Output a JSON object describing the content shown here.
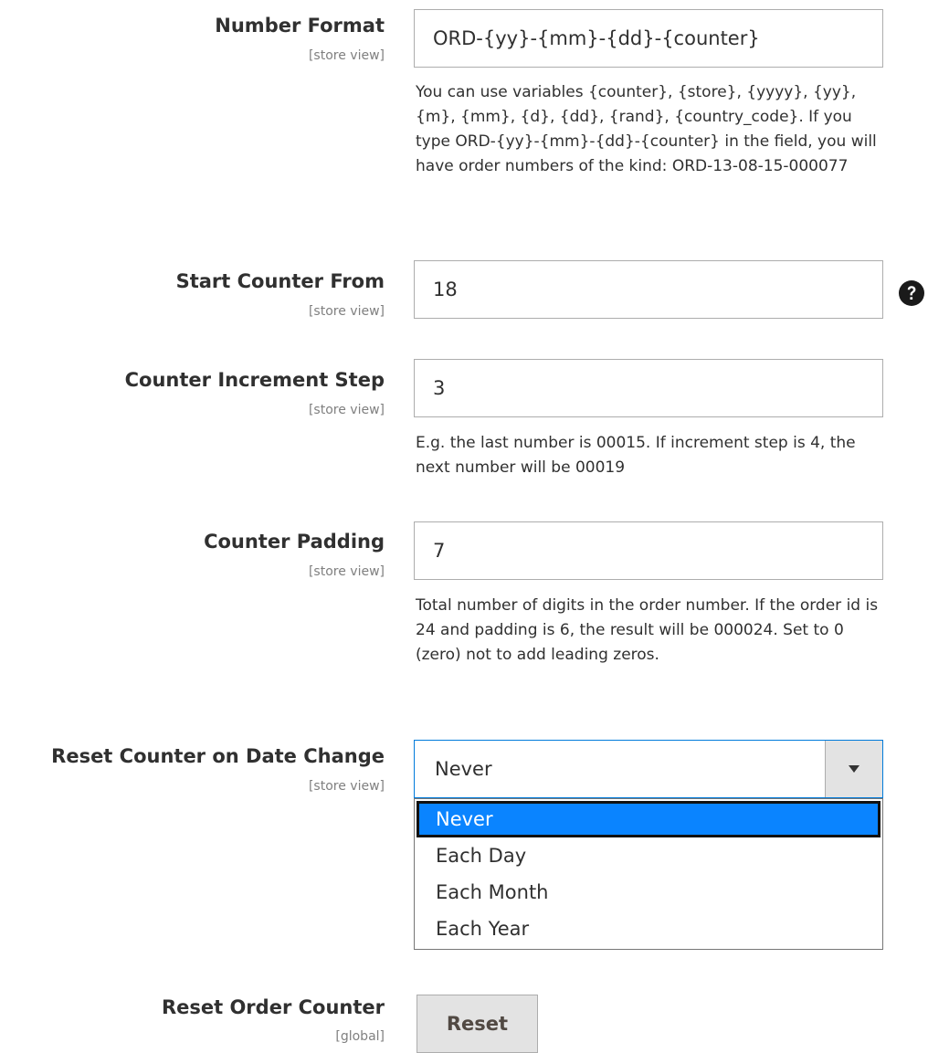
{
  "number_format": {
    "label": "Number Format",
    "scope": "[store view]",
    "value": "ORD-{yy}-{mm}-{dd}-{counter}",
    "note": "You can use variables {counter}, {store}, {yyyy}, {yy}, {m}, {mm}, {d}, {dd}, {rand}, {country_code}. If you type ORD-{yy}-{mm}-{dd}-{counter} in the field, you will have order numbers of the kind: ORD-13-08-15-000077"
  },
  "start_counter": {
    "label": "Start Counter From",
    "scope": "[store view]",
    "value": "18",
    "help_icon": "question-circle-icon"
  },
  "increment_step": {
    "label": "Counter Increment Step",
    "scope": "[store view]",
    "value": "3",
    "note": "E.g. the last number is 00015. If increment step is 4, the next number will be 00019"
  },
  "padding": {
    "label": "Counter Padding",
    "scope": "[store view]",
    "value": "7",
    "note": "Total number of digits in the order number. If the order id is 24 and padding is 6, the result will be 000024. Set to 0 (zero) not to add leading zeros."
  },
  "reset_on_date": {
    "label": "Reset Counter on Date Change",
    "scope": "[store view]",
    "selected": "Never",
    "options": [
      "Never",
      "Each Day",
      "Each Month",
      "Each Year"
    ],
    "arrow_icon": "caret-down-icon"
  },
  "reset_counter": {
    "label": "Reset Order Counter",
    "scope": "[global]",
    "button_label": "Reset"
  },
  "colors": {
    "focus_border": "#007bdb",
    "option_highlight": "#0a84ff",
    "text": "#303030",
    "scope_text": "#808080",
    "button_bg": "#e3e3e3"
  }
}
